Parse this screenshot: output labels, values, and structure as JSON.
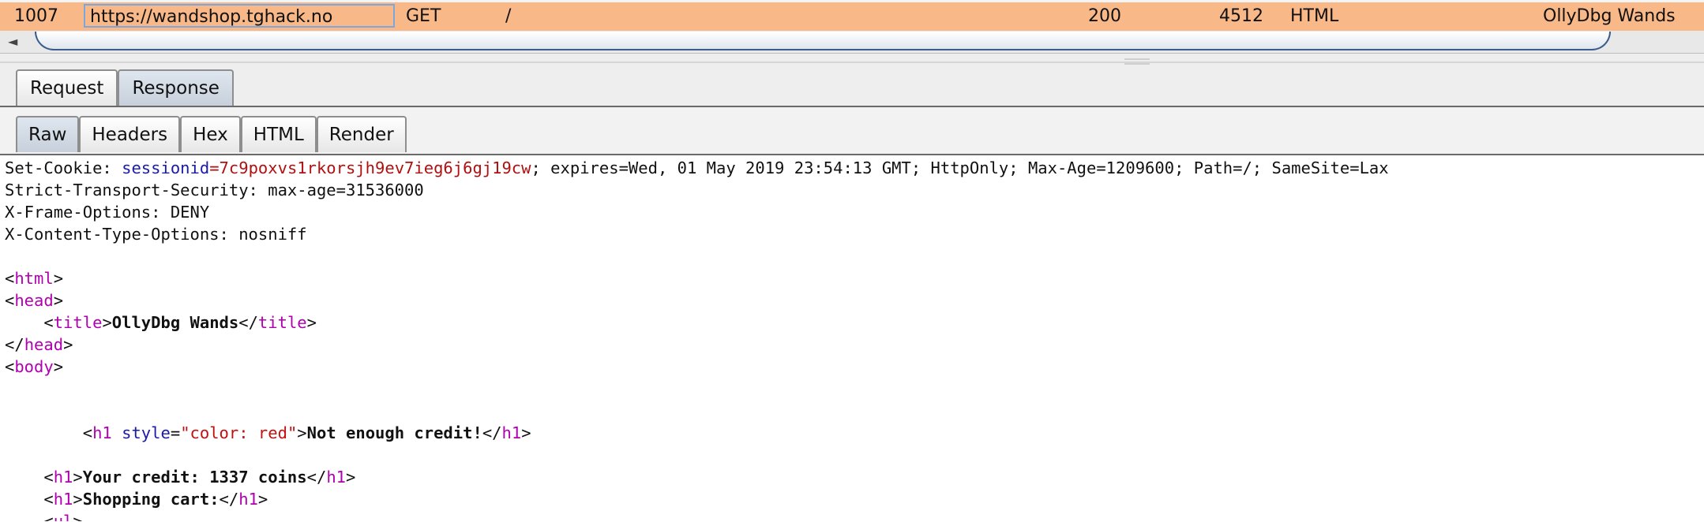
{
  "history_row": {
    "num": "1007",
    "host": "https://wandshop.tghack.no",
    "method": "GET",
    "url": "/",
    "status": "200",
    "length": "4512",
    "mime": "HTML",
    "title": "OllyDbg Wands"
  },
  "scrollbar": {
    "arrow": "◄"
  },
  "main_tabs": [
    {
      "label": "Request"
    },
    {
      "label": "Response",
      "active": true
    }
  ],
  "view_tabs": [
    {
      "label": "Raw",
      "active": true
    },
    {
      "label": "Headers"
    },
    {
      "label": "Hex"
    },
    {
      "label": "HTML"
    },
    {
      "label": "Render"
    }
  ],
  "response": {
    "set_cookie_key": "Set-Cookie: ",
    "session_name": "sessionid",
    "session_eq": "=",
    "session_value": "7c9poxvs1rkorsjh9ev7ieg6j6gj19cw",
    "cookie_rest": "; expires=Wed, 01 May 2019 23:54:13 GMT; HttpOnly; Max-Age=1209600; Path=/; SameSite=Lax",
    "hsts": "Strict-Transport-Security: max-age=31536000",
    "xfo": "X-Frame-Options: DENY",
    "xcto": "X-Content-Type-Options: nosniff",
    "title_text": "OllyDbg Wands",
    "h1_style_value": "\"color: red\"",
    "h1_not_enough": "Not enough credit!",
    "h1_credit": "Your credit: 1337 coins",
    "h1_cart": "Shopping cart:"
  },
  "colors": {
    "row_highlight": "#f8b887",
    "tag": "#b000b0",
    "attr": "#1a1aa8",
    "string": "#c01010"
  }
}
